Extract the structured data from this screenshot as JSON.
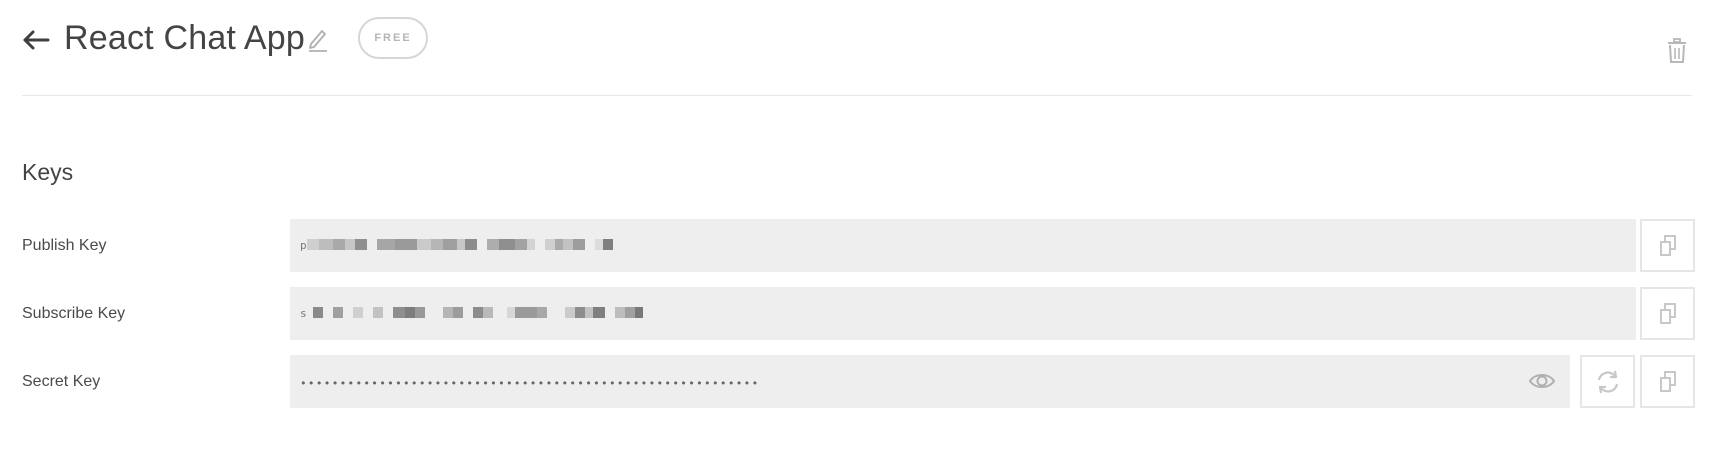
{
  "header": {
    "title": "React Chat App",
    "plan_badge": "FREE",
    "back_icon": "arrow-left-icon",
    "edit_icon": "pencil-icon",
    "delete_icon": "trash-icon"
  },
  "keys_section": {
    "title": "Keys",
    "rows": [
      {
        "label": "Publish Key",
        "value_prefix": "p",
        "value_redacted": true
      },
      {
        "label": "Subscribe Key",
        "value_prefix": "s",
        "value_redacted": true
      },
      {
        "label": "Secret Key",
        "value_masked": "••••••••••••••••••••••••••••••••••••••••••••••••••••••••••"
      }
    ],
    "icons": {
      "copy": "copy-icon",
      "regenerate": "refresh-icon",
      "reveal": "eye-icon"
    }
  },
  "colors": {
    "field_bg": "#eeeeee",
    "icon_gray": "#c8c8c8",
    "divider": "#e8e8e8"
  }
}
